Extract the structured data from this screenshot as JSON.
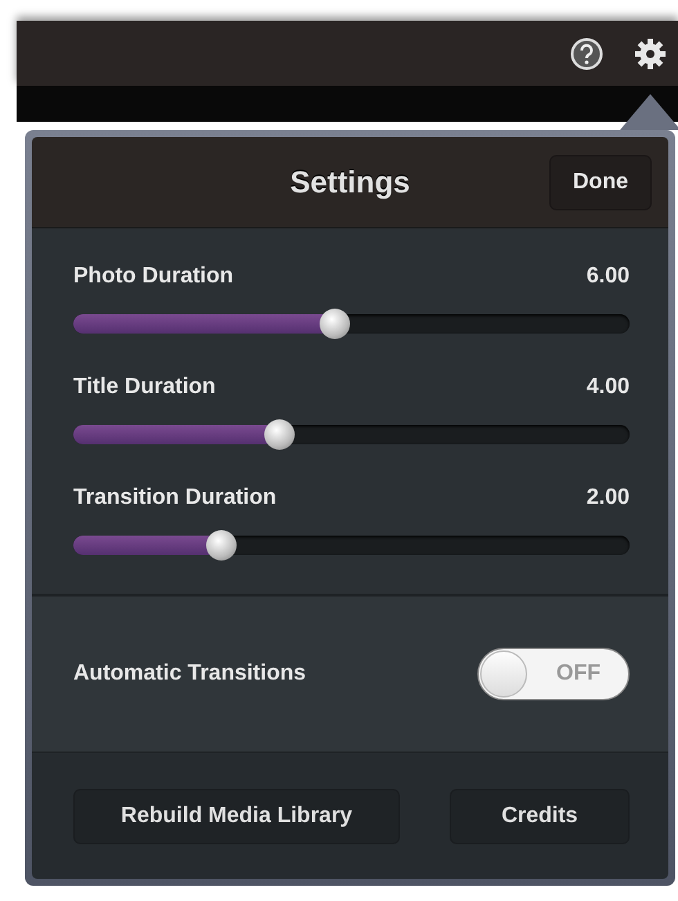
{
  "header": {
    "title": "Settings",
    "done_button": "Done"
  },
  "sliders": [
    {
      "label": "Photo Duration",
      "value": "6.00",
      "level": 0.47
    },
    {
      "label": "Title Duration",
      "value": "4.00",
      "level": 0.37
    },
    {
      "label": "Transition Duration",
      "value": "2.00",
      "level": 0.265
    }
  ],
  "toggle": {
    "label": "Automatic Transitions",
    "on": false,
    "state_text": "OFF"
  },
  "buttons": [
    "Rebuild Media Library",
    "Credits"
  ]
}
